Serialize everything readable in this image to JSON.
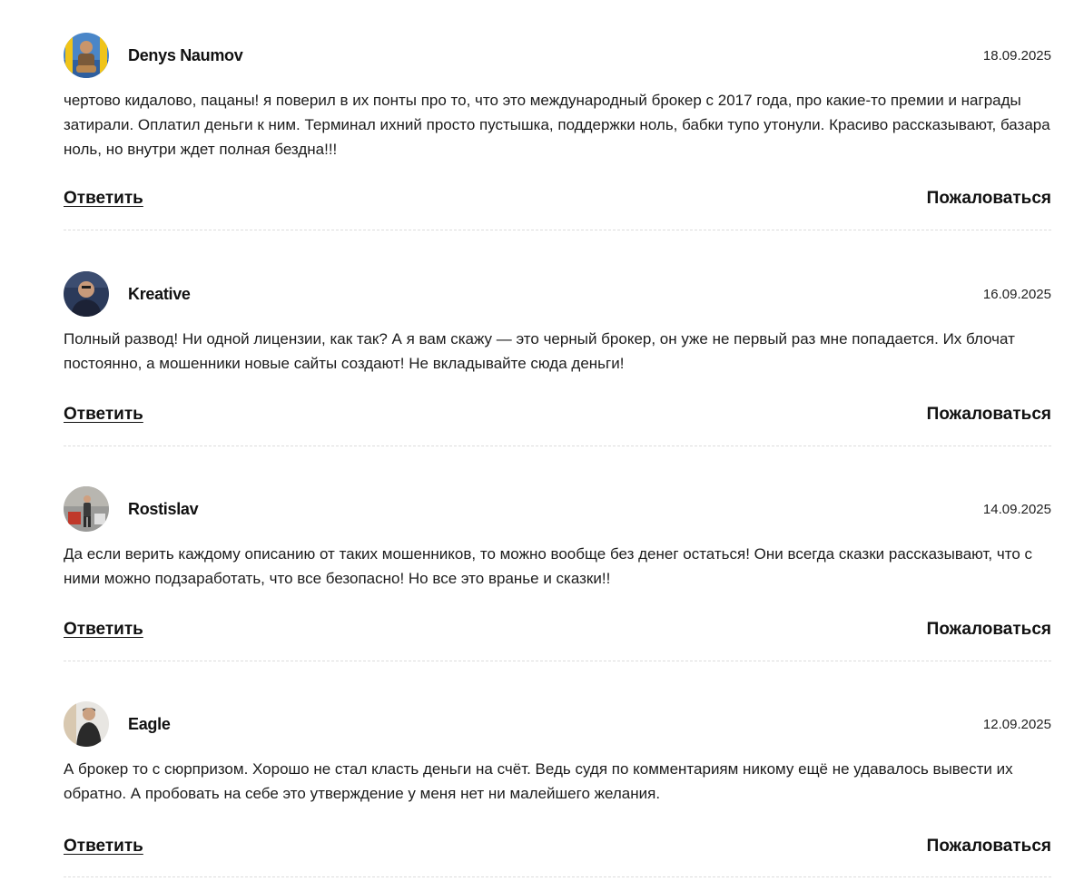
{
  "comments": [
    {
      "author": "Denys Naumov",
      "date": "18.09.2025",
      "text": "чертово кидалово, пацаны! я поверил в их понты про то, что это международный брокер с 2017 года, про какие-то премии и награды затирали. Оплатил деньги к ним. Терминал ихний просто пустышка, поддержки ноль, бабки тупо утонули. Красиво рассказывают, базара ноль, но внутри ждет полная бездна!!!",
      "reply_label": "Ответить",
      "report_label": "Пожаловаться",
      "avatar_colors": {
        "bg": "#4a86c8",
        "accent": "#f0c419",
        "figure": "#7a5a3a"
      }
    },
    {
      "author": "Kreative",
      "date": "16.09.2025",
      "text": "Полный развод! Ни одной лицензии, как так? А я вам скажу — это черный брокер, он уже не первый раз мне попадается. Их блочат постоянно, а мошенники новые сайты создают! Не вкладывайте сюда деньги!",
      "reply_label": "Ответить",
      "report_label": "Пожаловаться",
      "avatar_colors": {
        "bg": "#2b3a5a",
        "accent": "#c89a7a",
        "figure": "#1c2236"
      }
    },
    {
      "author": "Rostislav",
      "date": "14.09.2025",
      "text": "Да если верить каждому описанию от таких мошенников, то можно вообще без денег остаться! Они всегда сказки рассказывают, что с ними можно подзаработать, что все безопасно! Но все это вранье и сказки!!",
      "reply_label": "Ответить",
      "report_label": "Пожаловаться",
      "avatar_colors": {
        "bg": "#9a9a98",
        "accent": "#c0392b",
        "figure": "#3a3a3a"
      }
    },
    {
      "author": "Eagle",
      "date": "12.09.2025",
      "text": "А брокер то с сюрпризом. Хорошо не стал класть деньги на счёт. Ведь судя по комментариям никому ещё не удавалось вывести их обратно. А пробовать на себе это утверждение у меня нет ни малейшего желания.",
      "reply_label": "Ответить",
      "report_label": "Пожаловаться",
      "avatar_colors": {
        "bg": "#e8e6e2",
        "accent": "#d8c8b0",
        "figure": "#2a2a2a"
      }
    }
  ]
}
